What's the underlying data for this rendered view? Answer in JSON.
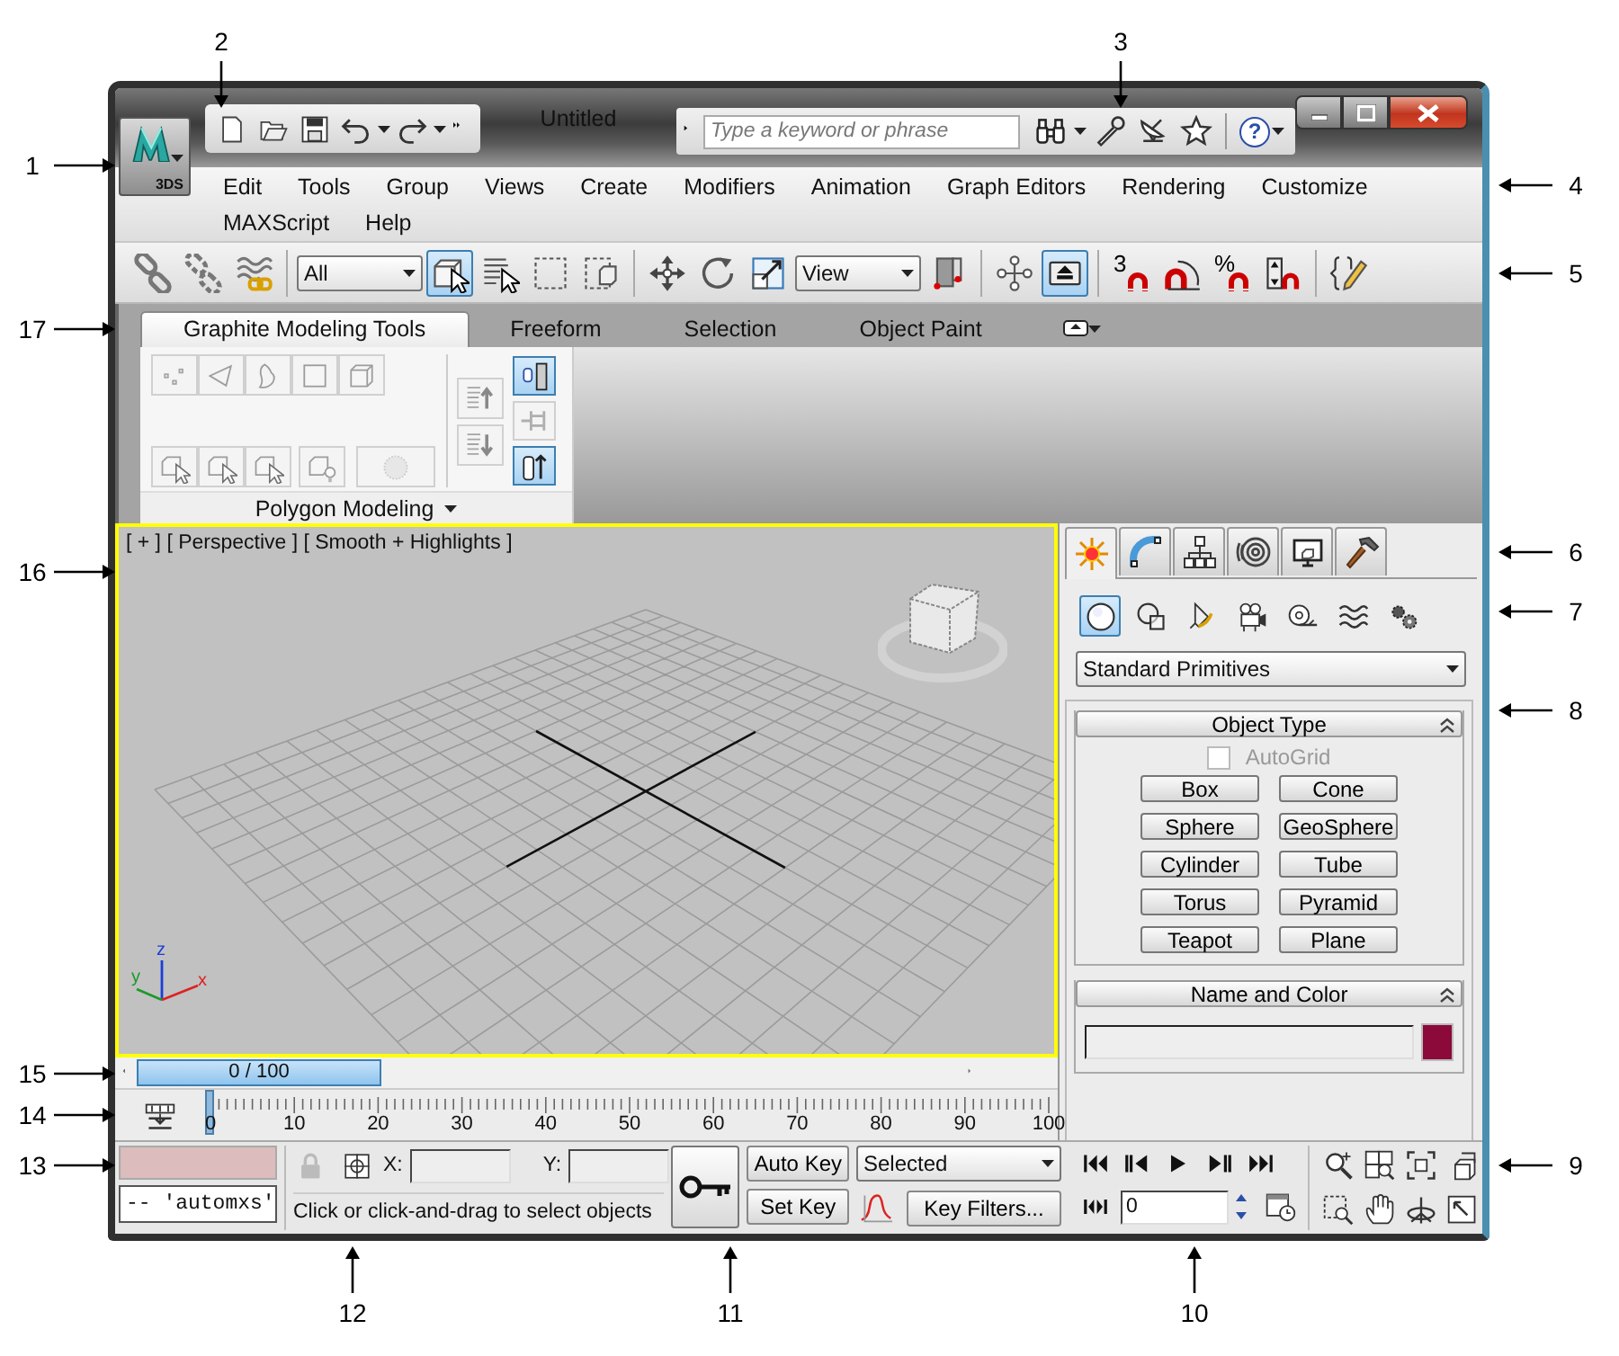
{
  "callouts": [
    "2",
    "3",
    "1",
    "4",
    "5",
    "17",
    "6",
    "16",
    "7",
    "8",
    "15",
    "14",
    "13",
    "9",
    "12",
    "11",
    "10"
  ],
  "app_button": {
    "label": "3DS"
  },
  "title": "Untitled",
  "search": {
    "placeholder": "Type a keyword or phrase"
  },
  "help": {
    "label": "?"
  },
  "menus": [
    "Edit",
    "Tools",
    "Group",
    "Views",
    "Create",
    "Modifiers",
    "Animation",
    "Graph Editors",
    "Rendering",
    "Customize",
    "MAXScript",
    "Help"
  ],
  "main_toolbar": [
    {
      "kind": "button",
      "selected": false
    },
    {
      "kind": "button",
      "selected": false
    },
    {
      "kind": "button",
      "selected": false
    },
    {
      "kind": "separator"
    },
    {
      "kind": "dropdown",
      "value": "All"
    },
    {
      "kind": "button",
      "selected": true
    },
    {
      "kind": "button",
      "selected": false
    },
    {
      "kind": "button",
      "selected": false
    },
    {
      "kind": "button",
      "selected": false
    },
    {
      "kind": "separator"
    },
    {
      "kind": "button",
      "selected": false
    },
    {
      "kind": "button",
      "selected": false
    },
    {
      "kind": "button",
      "selected": false
    },
    {
      "kind": "dropdown",
      "value": "View"
    },
    {
      "kind": "button",
      "selected": false
    },
    {
      "kind": "separator"
    },
    {
      "kind": "button",
      "selected": false
    },
    {
      "kind": "button",
      "selected": true
    },
    {
      "kind": "separator"
    },
    {
      "kind": "snap",
      "label": "3",
      "selected": false
    },
    {
      "kind": "button",
      "selected": false
    },
    {
      "kind": "snap",
      "label": "%",
      "selected": false
    },
    {
      "kind": "button",
      "selected": false
    },
    {
      "kind": "separator"
    },
    {
      "kind": "button",
      "selected": false
    }
  ],
  "ribbon": {
    "tabs": [
      {
        "label": "Graphite Modeling Tools",
        "selected": true
      },
      {
        "label": "Freeform",
        "selected": false
      },
      {
        "label": "Selection",
        "selected": false
      },
      {
        "label": "Object Paint",
        "selected": false
      }
    ],
    "panel": {
      "title": "Polygon Modeling",
      "buttons": [
        {
          "selected": false,
          "disabled": true
        },
        {
          "selected": false,
          "disabled": true
        },
        {
          "selected": false,
          "disabled": true
        },
        {
          "selected": false,
          "disabled": true
        },
        {
          "selected": false,
          "disabled": true
        },
        {
          "selected": false,
          "disabled": true
        },
        {
          "selected": false,
          "disabled": true
        },
        {
          "selected": false,
          "disabled": true
        },
        {
          "selected": false,
          "disabled": true
        },
        {
          "selected": false,
          "disabled": true
        },
        {
          "selected": false,
          "disabled": true
        },
        {
          "selected": false,
          "disabled": true
        },
        {
          "selected": true,
          "disabled": false
        },
        {
          "selected": false,
          "disabled": true
        },
        {
          "selected": true,
          "disabled": false
        }
      ]
    }
  },
  "viewport": {
    "label": "[ + ] [ Perspective ] [ Smooth + Highlights ]",
    "active": true,
    "axes": [
      "z",
      "y",
      "x"
    ]
  },
  "command_panel": {
    "tabs": [
      {
        "selected": true
      },
      {
        "selected": false
      },
      {
        "selected": false
      },
      {
        "selected": false
      },
      {
        "selected": false
      },
      {
        "selected": false
      }
    ],
    "categories": [
      {
        "selected": true
      },
      {
        "selected": false
      },
      {
        "selected": false
      },
      {
        "selected": false
      },
      {
        "selected": false
      },
      {
        "selected": false
      },
      {
        "selected": false
      }
    ],
    "dropdown": "Standard Primitives",
    "rollouts": [
      {
        "kind": "object_type",
        "title": "Object Type",
        "autogrid": {
          "label": "AutoGrid",
          "checked": false,
          "disabled": true
        },
        "buttons": [
          "Box",
          "Cone",
          "Sphere",
          "GeoSphere",
          "Cylinder",
          "Tube",
          "Torus",
          "Pyramid",
          "Teapot",
          "Plane"
        ]
      },
      {
        "kind": "name_color",
        "title": "Name and Color",
        "color": "#8b0a3a"
      }
    ]
  },
  "time_slider": {
    "label": "0 / 100",
    "level": 0
  },
  "trackbar": {
    "ticks": [
      "0",
      "10",
      "20",
      "30",
      "40",
      "50",
      "60",
      "70",
      "80",
      "90",
      "100"
    ]
  },
  "status": {
    "listener_output": "-- 'automxs'",
    "x_label": "X:",
    "y_label": "Y:",
    "prompt": "Click or click-and-drag to select objects",
    "auto_key": "Auto Key",
    "set_key": "Set Key",
    "key_mode": "Selected",
    "key_filters": "Key Filters...",
    "frame": "0"
  }
}
